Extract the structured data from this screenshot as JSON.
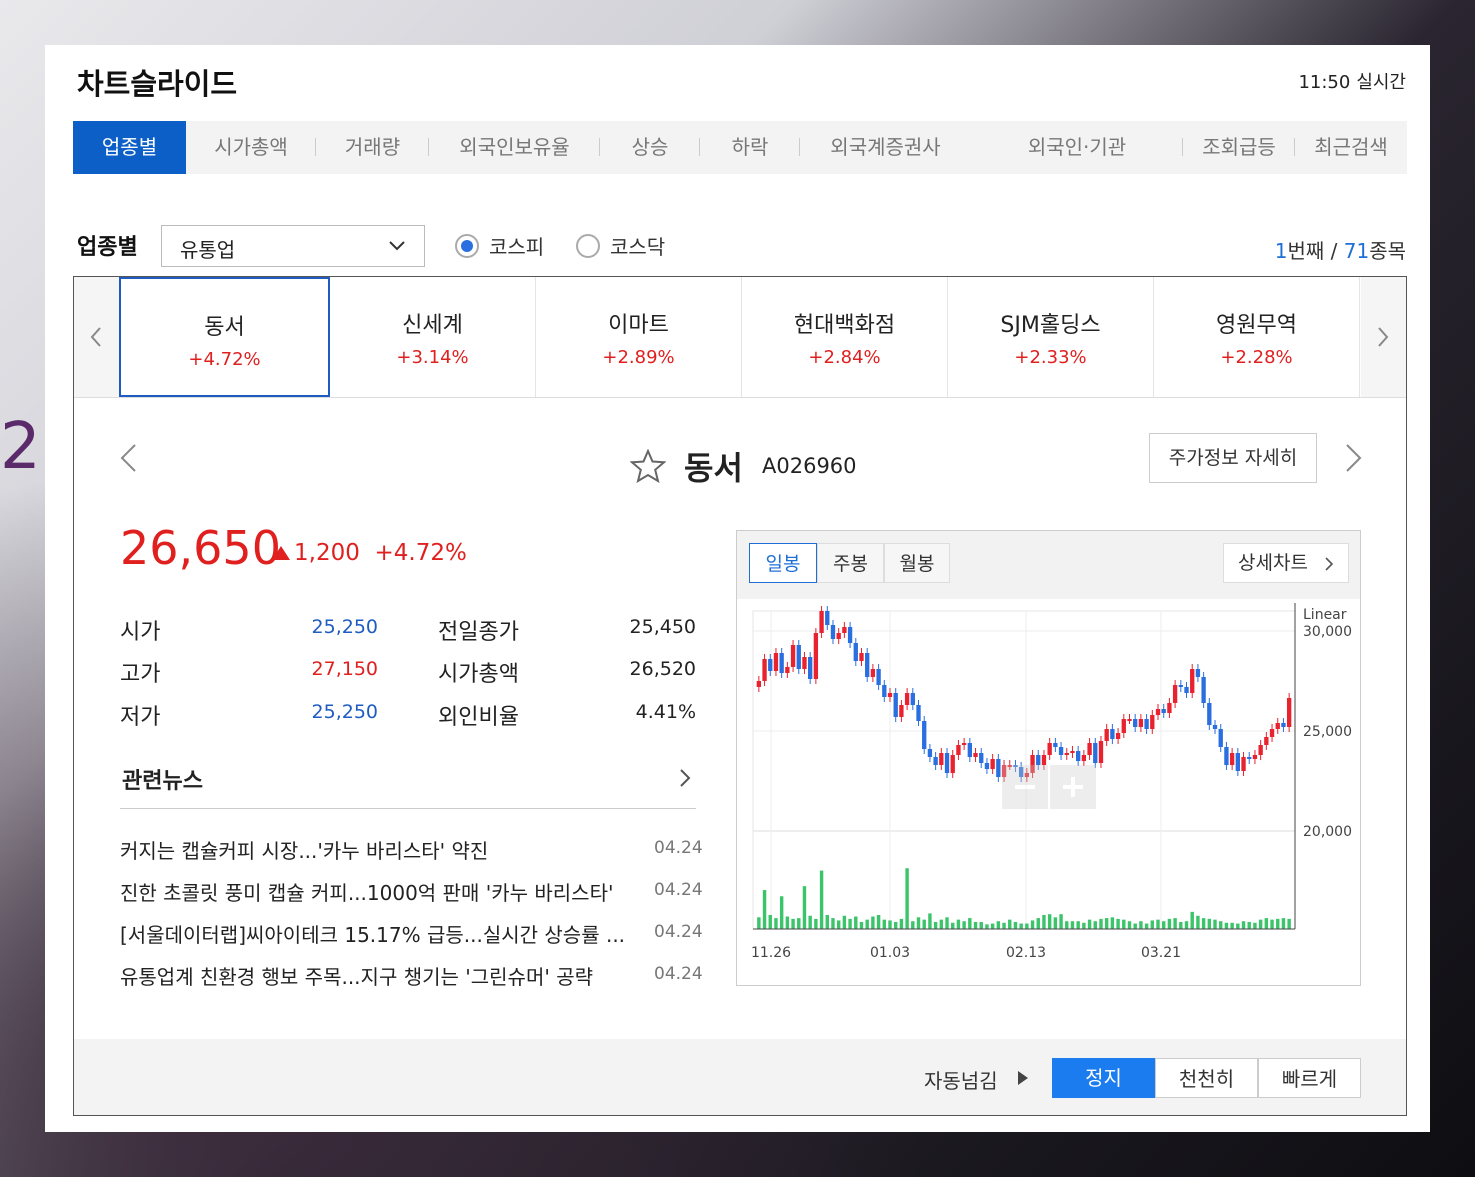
{
  "header": {
    "title": "차트슬라이드",
    "time": "11:50",
    "realtime_label": "실시간"
  },
  "tabs": [
    {
      "label": "업종별",
      "active": true
    },
    {
      "label": "시가총액"
    },
    {
      "label": "거래량"
    },
    {
      "label": "외국인보유율"
    },
    {
      "label": "상승"
    },
    {
      "label": "하락"
    },
    {
      "label": "외국계증권사"
    },
    {
      "label": "외국인·기관"
    },
    {
      "label": "조회급등"
    },
    {
      "label": "최근검색"
    }
  ],
  "filter": {
    "label": "업종별",
    "selected": "유통업",
    "markets": [
      {
        "label": "코스피",
        "selected": true
      },
      {
        "label": "코스닥",
        "selected": false
      }
    ],
    "position_current": "1",
    "position_unit": "번째",
    "position_sep": " / ",
    "total": "71",
    "total_unit": "종목"
  },
  "stocks": [
    {
      "name": "동서",
      "change": "+4.72%"
    },
    {
      "name": "신세계",
      "change": "+3.14%"
    },
    {
      "name": "이마트",
      "change": "+2.89%"
    },
    {
      "name": "현대백화점",
      "change": "+2.84%"
    },
    {
      "name": "SJM홀딩스",
      "change": "+2.33%"
    },
    {
      "name": "영원무역",
      "change": "+2.28%"
    }
  ],
  "detail": {
    "name": "동서",
    "code": "A026960",
    "info_button": "주가정보 자세히",
    "price": "26,650",
    "change": "1,200",
    "change_pct": "+4.72%",
    "fields": [
      {
        "label": "시가",
        "value": "25,250",
        "tone": "blue"
      },
      {
        "label": "고가",
        "value": "27,150",
        "tone": "red"
      },
      {
        "label": "저가",
        "value": "25,250",
        "tone": "blue"
      },
      {
        "label": "전일종가",
        "value": "25,450",
        "tone": "dark"
      },
      {
        "label": "시가총액",
        "value": "26,520",
        "tone": "dark"
      },
      {
        "label": "외인비율",
        "value": "4.41%",
        "tone": "dark"
      }
    ]
  },
  "news": {
    "title": "관련뉴스",
    "items": [
      {
        "headline": "커지는 캡슐커피 시장...'카누 바리스타' 약진",
        "date": "04.24"
      },
      {
        "headline": "진한 초콜릿 풍미 캡슐 커피...1000억 판매 '카누 바리스타'",
        "date": "04.24"
      },
      {
        "headline": "[서울데이터랩]씨아이테크 15.17% 급등...실시간 상승률 ...",
        "date": "04.24"
      },
      {
        "headline": "유통업계 친환경 행보 주목...지구 챙기는 '그린슈머' 공략",
        "date": "04.24"
      }
    ]
  },
  "chart_tabs": [
    {
      "label": "일봉",
      "active": true
    },
    {
      "label": "주봉"
    },
    {
      "label": "월봉"
    }
  ],
  "chart_detail_button": "상세차트",
  "chart_data": {
    "type": "candlestick",
    "scale_label": "Linear",
    "y_ticks": [
      "30,000",
      "25,000",
      "20,000"
    ],
    "x_ticks": [
      "11.26",
      "01.03",
      "02.13",
      "03.21"
    ],
    "ylim": [
      20000,
      31000
    ],
    "up_color": "#e8222e",
    "down_color": "#2a6fe0",
    "volume_color": "#3cc46a",
    "closes": [
      27500,
      28600,
      28000,
      28900,
      27900,
      28200,
      29300,
      28100,
      28700,
      27600,
      29900,
      31000,
      30300,
      29600,
      29900,
      30200,
      29400,
      28500,
      28900,
      27700,
      28100,
      27300,
      26700,
      26900,
      25700,
      26300,
      26900,
      26300,
      25500,
      24100,
      23700,
      23300,
      23900,
      22900,
      23800,
      24300,
      24400,
      23700,
      23900,
      23400,
      23100,
      23600,
      22700,
      23300,
      23300,
      23200,
      22700,
      22900,
      23800,
      23300,
      23800,
      24400,
      24200,
      23800,
      23900,
      24000,
      23500,
      23800,
      24400,
      23400,
      24500,
      25100,
      24600,
      24900,
      25600,
      25600,
      25200,
      25600,
      25100,
      25800,
      26100,
      25900,
      26400,
      27300,
      27200,
      26900,
      28100,
      27700,
      26400,
      25300,
      25100,
      24200,
      23300,
      23900,
      23000,
      23700,
      23600,
      23800,
      24300,
      24700,
      25100,
      25400,
      25200,
      26650
    ],
    "volumes": [
      0.15,
      0.5,
      0.18,
      0.14,
      0.42,
      0.16,
      0.13,
      0.14,
      0.55,
      0.17,
      0.13,
      0.75,
      0.18,
      0.14,
      0.11,
      0.17,
      0.13,
      0.16,
      0.09,
      0.12,
      0.16,
      0.18,
      0.12,
      0.11,
      0.09,
      0.13,
      0.78,
      0.1,
      0.15,
      0.12,
      0.2,
      0.09,
      0.12,
      0.15,
      0.08,
      0.12,
      0.1,
      0.14,
      0.09,
      0.09,
      0.06,
      0.07,
      0.1,
      0.08,
      0.12,
      0.09,
      0.07,
      0.07,
      0.11,
      0.14,
      0.18,
      0.19,
      0.15,
      0.19,
      0.1,
      0.1,
      0.1,
      0.08,
      0.12,
      0.1,
      0.13,
      0.14,
      0.15,
      0.13,
      0.12,
      0.1,
      0.07,
      0.1,
      0.07,
      0.11,
      0.12,
      0.1,
      0.13,
      0.14,
      0.09,
      0.1,
      0.22,
      0.17,
      0.14,
      0.13,
      0.12,
      0.1,
      0.08,
      0.08,
      0.07,
      0.1,
      0.09,
      0.08,
      0.12,
      0.14,
      0.12,
      0.13,
      0.14,
      0.13
    ]
  },
  "footer": {
    "auto_label": "자동넘김",
    "buttons": [
      {
        "label": "정지",
        "active": true
      },
      {
        "label": "천천히"
      },
      {
        "label": "빠르게"
      }
    ]
  }
}
